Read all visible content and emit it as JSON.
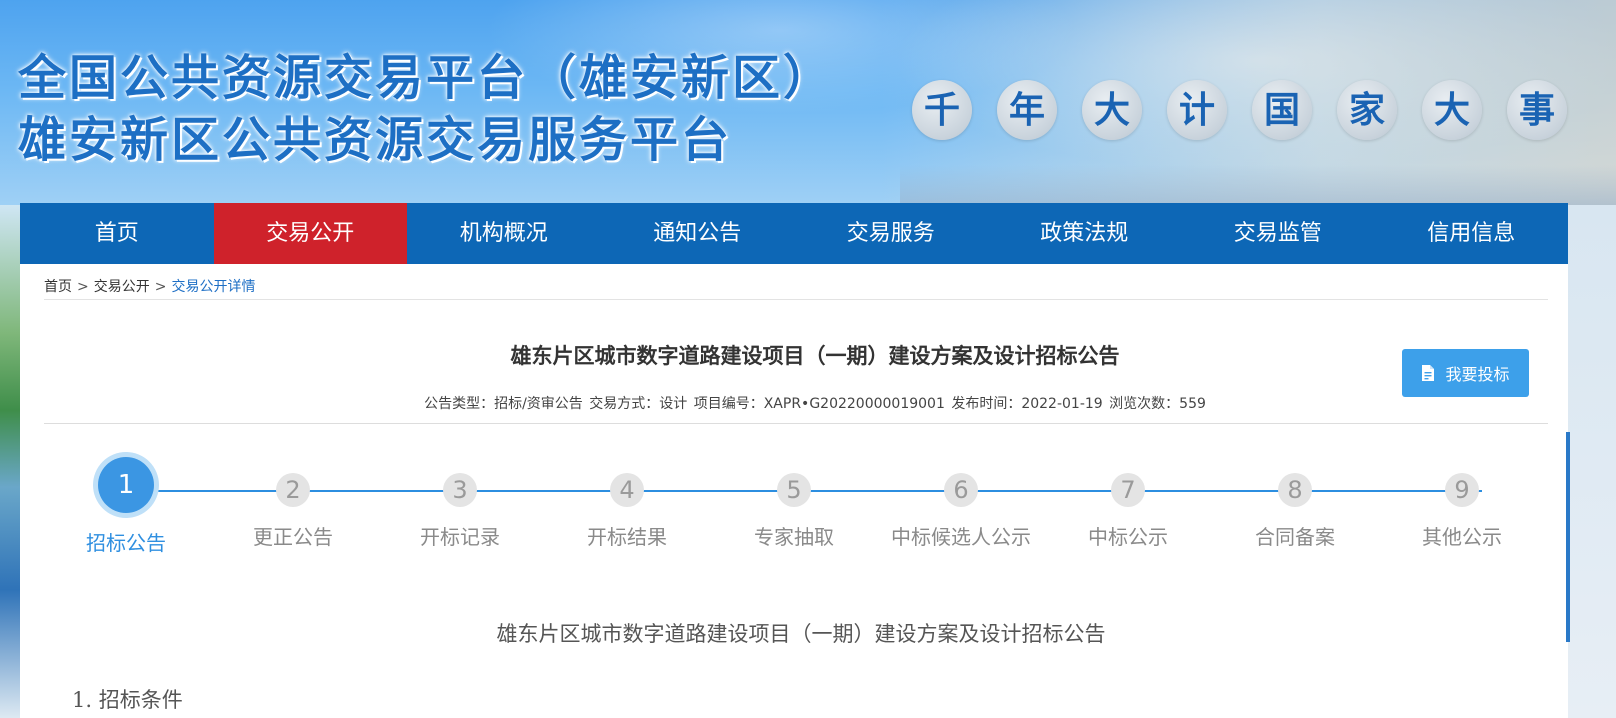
{
  "header": {
    "title_line1": "全国公共资源交易平台（雄安新区）",
    "title_line2": "雄安新区公共资源交易服务平台",
    "slogan_chars": [
      "千",
      "年",
      "大",
      "计",
      "国",
      "家",
      "大",
      "事"
    ]
  },
  "nav": {
    "items": [
      "首页",
      "交易公开",
      "机构概况",
      "通知公告",
      "交易服务",
      "政策法规",
      "交易监管",
      "信用信息"
    ],
    "active_index": 1
  },
  "breadcrumb": {
    "items": [
      "首页",
      "交易公开",
      "交易公开详情"
    ],
    "separator": ">"
  },
  "notice": {
    "title": "雄东片区城市数字道路建设项目（一期）建设方案及设计招标公告",
    "meta": {
      "type": "公告类型：招标/资审公告",
      "method": "交易方式：设计",
      "project_no": "项目编号：XAPR•G20220000019001",
      "publish_time": "发布时间：2022-01-19",
      "views": "浏览次数：559"
    },
    "bid_button": "我要投标"
  },
  "steps": [
    {
      "num": "1",
      "label": "招标公告",
      "active": true
    },
    {
      "num": "2",
      "label": "更正公告",
      "active": false
    },
    {
      "num": "3",
      "label": "开标记录",
      "active": false
    },
    {
      "num": "4",
      "label": "开标结果",
      "active": false
    },
    {
      "num": "5",
      "label": "专家抽取",
      "active": false
    },
    {
      "num": "6",
      "label": "中标候选人公示",
      "active": false
    },
    {
      "num": "7",
      "label": "中标公示",
      "active": false
    },
    {
      "num": "8",
      "label": "合同备案",
      "active": false
    },
    {
      "num": "9",
      "label": "其他公示",
      "active": false
    }
  ],
  "document": {
    "heading": "雄东片区城市数字道路建设项目（一期）建设方案及设计招标公告",
    "section1": "1. 招标条件"
  },
  "colors": {
    "nav_bg": "#0d67b6",
    "nav_active": "#cf222b",
    "title_blue": "#1d6fc4",
    "step_active": "#3b96e3",
    "button_bg": "#3da0ea"
  }
}
